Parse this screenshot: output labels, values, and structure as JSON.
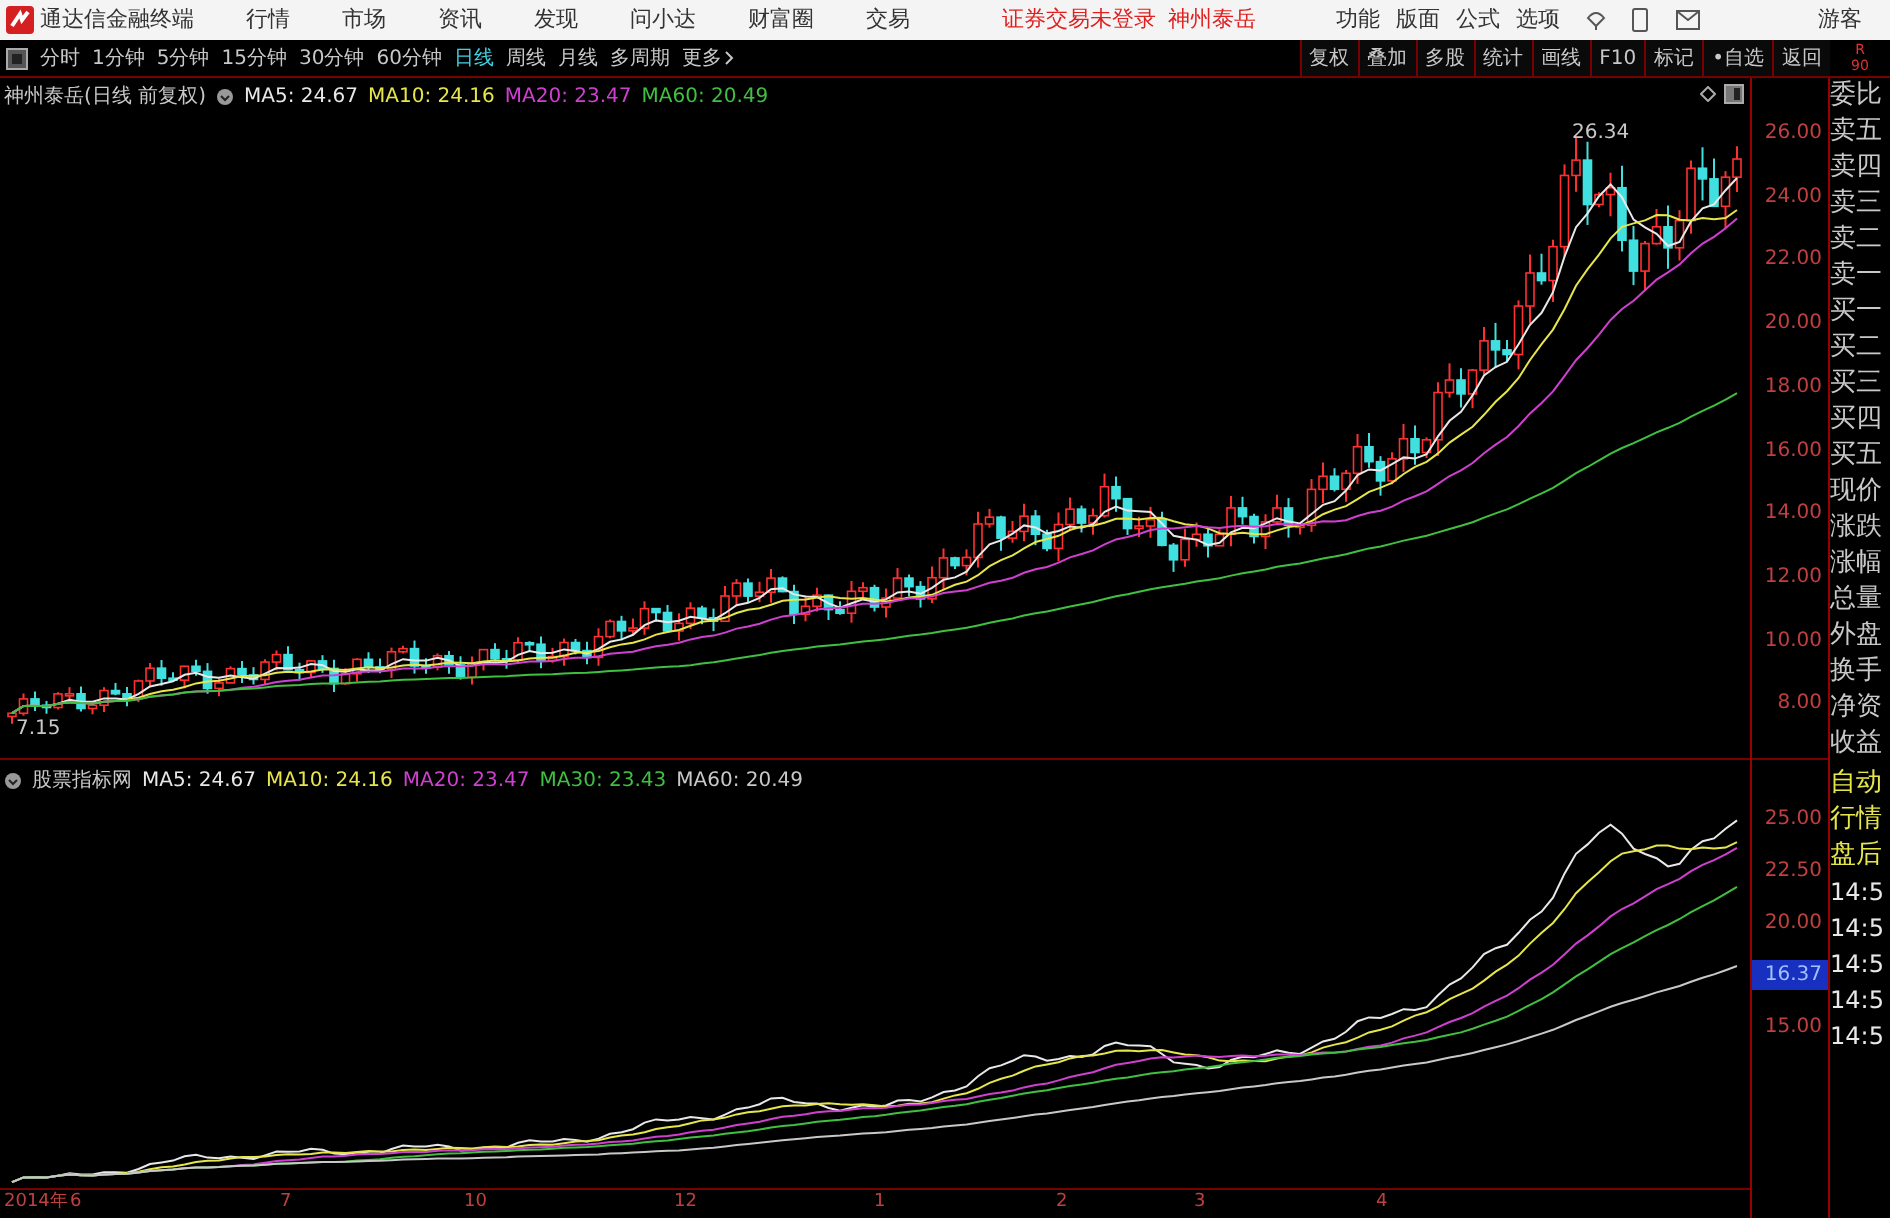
{
  "app": {
    "title": "通达信金融终端",
    "menu": [
      "行情",
      "市场",
      "资讯",
      "发现",
      "问小达",
      "财富圈",
      "交易"
    ],
    "login_status": "证券交易未登录",
    "stock_link": "神州泰岳",
    "tools": [
      "功能",
      "版面",
      "公式",
      "选项"
    ],
    "user": "游客"
  },
  "periods": [
    {
      "label": "分时",
      "selected": false
    },
    {
      "label": "1分钟",
      "selected": false
    },
    {
      "label": "5分钟",
      "selected": false
    },
    {
      "label": "15分钟",
      "selected": false
    },
    {
      "label": "30分钟",
      "selected": false
    },
    {
      "label": "60分钟",
      "selected": false
    },
    {
      "label": "日线",
      "selected": true
    },
    {
      "label": "周线",
      "selected": false
    },
    {
      "label": "月线",
      "selected": false
    },
    {
      "label": "多周期",
      "selected": false
    }
  ],
  "more": "更多",
  "chart_tools": [
    "复权",
    "叠加",
    "多股",
    "统计",
    "画线",
    "F10",
    "标记",
    "•自选",
    "返回"
  ],
  "corner": [
    "R",
    "90"
  ],
  "main_chart": {
    "title": "神州泰岳(日线 前复权)",
    "ma": [
      {
        "label": "MA5: 24.67",
        "color": "#e8e8e8"
      },
      {
        "label": "MA10: 24.16",
        "color": "#e6e64a"
      },
      {
        "label": "MA20: 23.47",
        "color": "#d040d0"
      },
      {
        "label": "MA60: 20.49",
        "color": "#40c040"
      }
    ],
    "high_label": "26.34",
    "low_label": "7.15",
    "axis": [
      "26.00",
      "24.00",
      "22.00",
      "20.00",
      "18.00",
      "16.00",
      "14.00",
      "12.00",
      "10.00",
      "8.00"
    ]
  },
  "indicator": {
    "title": "股票指标网",
    "ma": [
      {
        "label": "MA5: 24.67",
        "color": "#e8e8e8"
      },
      {
        "label": "MA10: 24.16",
        "color": "#e6e64a"
      },
      {
        "label": "MA20: 23.47",
        "color": "#d040d0"
      },
      {
        "label": "MA30: 23.43",
        "color": "#40c040"
      },
      {
        "label": "MA60: 20.49",
        "color": "#c8c8c8"
      }
    ],
    "axis": [
      {
        "label": "25.00",
        "kind": "tick"
      },
      {
        "label": "22.50",
        "kind": "tick"
      },
      {
        "label": "20.00",
        "kind": "tick"
      },
      {
        "label": "16.37",
        "kind": "current"
      },
      {
        "label": "15.00",
        "kind": "tick"
      }
    ]
  },
  "dates": [
    "2014年",
    "6",
    "7",
    "10",
    "12",
    "1",
    "2",
    "3",
    "4"
  ],
  "quote_panel": {
    "fields": [
      "委比",
      "卖五",
      "卖四",
      "卖三",
      "卖二",
      "卖一",
      "买一",
      "买二",
      "买三",
      "买四",
      "买五",
      "现价",
      "涨跌",
      "涨幅",
      "总量",
      "外盘",
      "换手",
      "净资",
      "收益"
    ],
    "modes": [
      "自动",
      "行情",
      "盘后"
    ],
    "times": [
      "14:5",
      "14:5",
      "14:5",
      "14:5",
      "14:5"
    ]
  }
}
